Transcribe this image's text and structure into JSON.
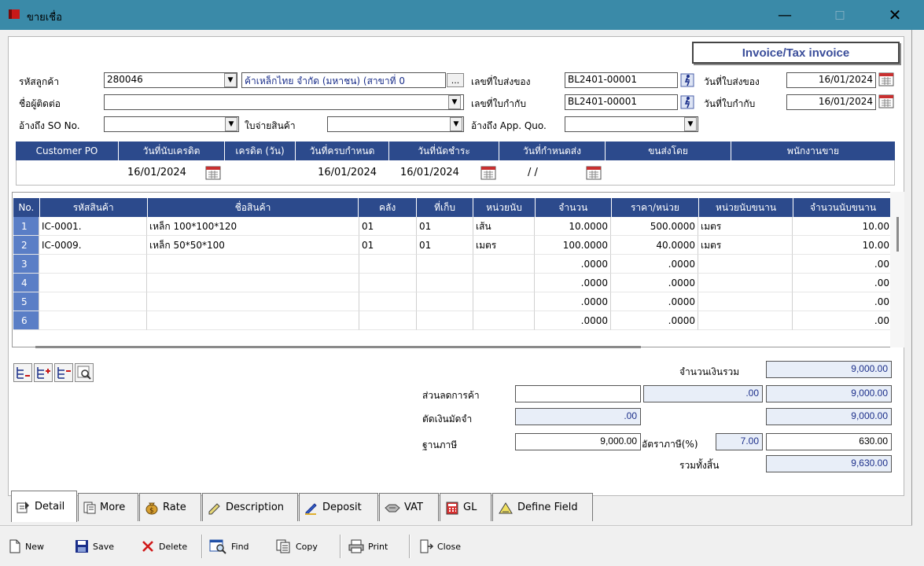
{
  "window": {
    "title": "ขายเชื่อ",
    "accent": "#3a8aa8"
  },
  "header": {
    "doc_type": "Invoice/Tax invoice",
    "customer_code_label": "รหัสลูกค้า",
    "customer_code": "280046",
    "customer_name": "ค้าเหล็กไทย จำกัด (มหาชน) (สาขาที่ 0",
    "contact_label": "ชื่อผู้ติดต่อ",
    "contact": "",
    "ref_so_label": "อ้างถึง SO No.",
    "ref_so": "",
    "issue_label": "ใบจ่ายสินค้า",
    "issue": "",
    "ref_quo_label": "อ้างถึง App. Quo.",
    "ref_quo": "",
    "delivery_no_label": "เลขที่ใบส่งของ",
    "delivery_no": "BL2401-00001",
    "tax_no_label": "เลขที่ใบกำกับ",
    "tax_no": "BL2401-00001",
    "delivery_date_label": "วันที่ใบส่งของ",
    "delivery_date": "16/01/2024",
    "tax_date_label": "วันที่ใบกำกับ",
    "tax_date": "16/01/2024"
  },
  "info": {
    "headers": [
      "Customer PO",
      "วันที่นับเครดิต",
      "เครดิต (วัน)",
      "วันที่ครบกำหนด",
      "วันที่นัดชำระ",
      "วันที่กำหนดส่ง",
      "ขนส่งโดย",
      "พนักงานขาย"
    ],
    "values": [
      "",
      "16/01/2024",
      "",
      "16/01/2024",
      "16/01/2024",
      "/ /",
      "",
      ""
    ]
  },
  "grid": {
    "headers": [
      "No.",
      "รหัสสินค้า",
      "ชื่อสินค้า",
      "คลัง",
      "ที่เก็บ",
      "หน่วยนับ",
      "จำนวน",
      "ราคา/หน่วย",
      "หน่วยนับขนาน",
      "จำนวนนับขนาน"
    ],
    "rows": [
      [
        "1",
        "IC-0001.",
        "เหล็ก 100*100*120",
        "01",
        "01",
        "เส้น",
        "10.0000",
        "500.0000",
        "เมตร",
        "10.00"
      ],
      [
        "2",
        "IC-0009.",
        "เหล็ก 50*50*100",
        "01",
        "01",
        "เมตร",
        "100.0000",
        "40.0000",
        "เมตร",
        "10.00"
      ],
      [
        "3",
        "",
        "",
        "",
        "",
        "",
        ".0000",
        ".0000",
        "",
        ".00"
      ],
      [
        "4",
        "",
        "",
        "",
        "",
        "",
        ".0000",
        ".0000",
        "",
        ".00"
      ],
      [
        "5",
        "",
        "",
        "",
        "",
        "",
        ".0000",
        ".0000",
        "",
        ".00"
      ],
      [
        "6",
        "",
        "",
        "",
        "",
        "",
        ".0000",
        ".0000",
        "",
        ".00"
      ]
    ]
  },
  "totals": {
    "sum_label": "จำนวนเงินรวม",
    "sum": "9,000.00",
    "discount_label": "ส่วนลดการค้า",
    "discount_text": "",
    "discount_amt": ".00",
    "after_discount": "9,000.00",
    "deposit_label": "ตัดเงินมัดจำ",
    "deposit": ".00",
    "after_deposit": "9,000.00",
    "tax_base_label": "ฐานภาษี",
    "tax_base": "9,000.00",
    "vat_rate_label": "อัตราภาษี(%)",
    "vat_rate": "7.00",
    "vat_amt": "630.00",
    "grand_label": "รวมทั้งสิ้น",
    "grand": "9,630.00"
  },
  "tabs": [
    "Detail",
    "More",
    "Rate",
    "Description",
    "Deposit",
    "VAT",
    "GL",
    "Define Field"
  ],
  "toolbar": {
    "new": "New",
    "save": "Save",
    "delete": "Delete",
    "find": "Find",
    "copy": "Copy",
    "print": "Print",
    "close": "Close"
  }
}
